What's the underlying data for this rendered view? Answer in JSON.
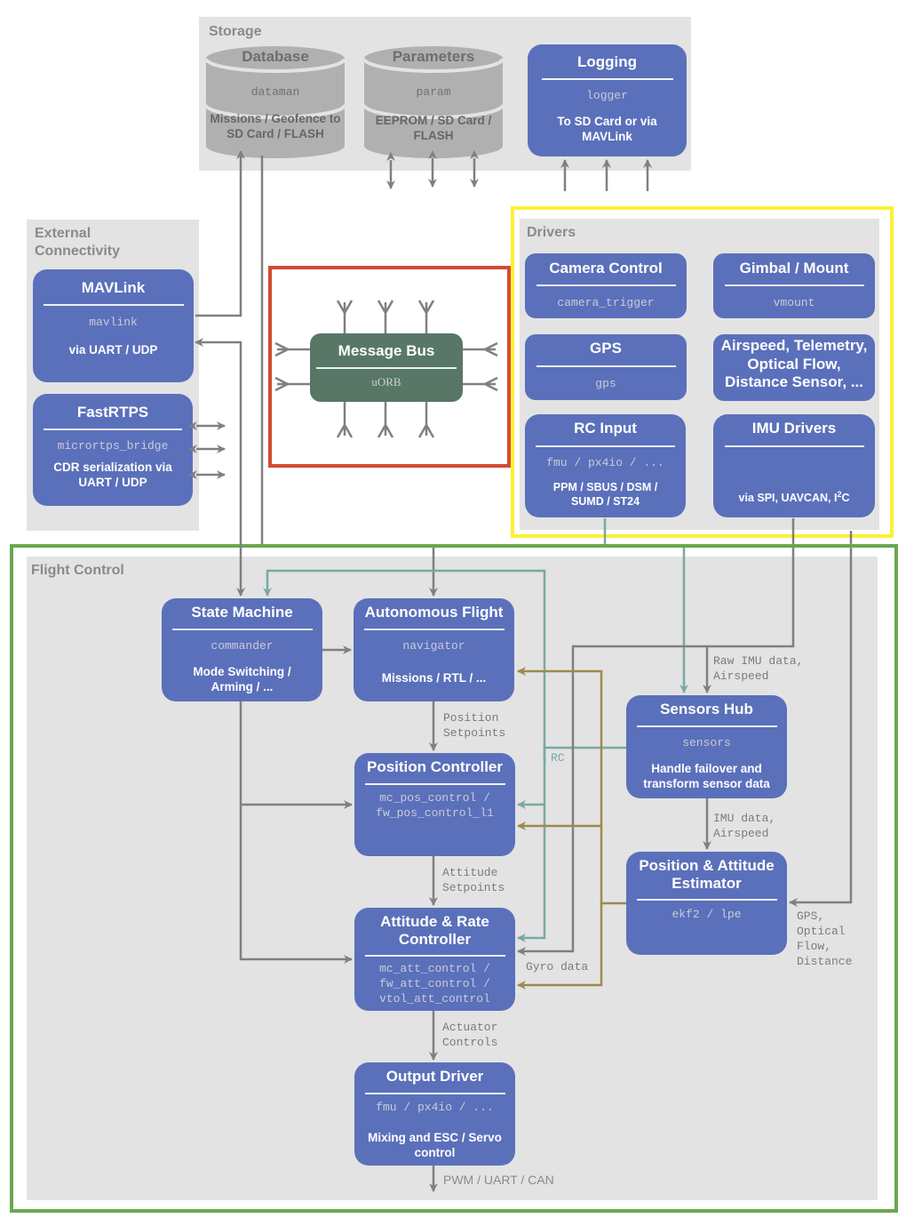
{
  "colors": {
    "module_box": "#5b70bb",
    "message_bus": "#587766",
    "group_bg": "#e3e3e3",
    "storage_cylinder": "#b0b0b0",
    "connector_gray": "#808080",
    "connector_teal": "#7aa8a4",
    "connector_olive": "#9c8a4c",
    "highlight_red": "#d34a34",
    "highlight_yellow": "#fdf035",
    "highlight_green": "#6aa84f"
  },
  "storage": {
    "title": "Storage",
    "database": {
      "title": "Database",
      "module": "dataman",
      "desc": "Missions / Geofence to SD Card / FLASH"
    },
    "parameters": {
      "title": "Parameters",
      "module": "param",
      "desc": "EEPROM / SD Card / FLASH"
    },
    "logging": {
      "title": "Logging",
      "module": "logger",
      "desc": "To SD Card or via MAVLink"
    }
  },
  "external": {
    "title": "External Connectivity",
    "mavlink": {
      "title": "MAVLink",
      "module": "mavlink",
      "desc": "via UART / UDP"
    },
    "fastrtps": {
      "title": "FastRTPS",
      "module": "micrortps_bridge",
      "desc": "CDR serialization via UART / UDP"
    }
  },
  "message_bus": {
    "title": "Message Bus",
    "module": "uORB"
  },
  "drivers": {
    "title": "Drivers",
    "camera": {
      "title": "Camera Control",
      "module": "camera_trigger"
    },
    "gimbal": {
      "title": "Gimbal / Mount",
      "module": "vmount"
    },
    "gps": {
      "title": "GPS",
      "module": "gps"
    },
    "other": {
      "title": "Airspeed, Telemetry, Optical Flow, Distance Sensor, ..."
    },
    "rc": {
      "title": "RC Input",
      "module": "fmu / px4io / ...",
      "desc": "PPM / SBUS / DSM / SUMD / ST24"
    },
    "imu": {
      "title": "IMU Drivers",
      "desc_main": "via SPI, UAVCAN, I",
      "desc_sup": "2",
      "desc_end": "C"
    }
  },
  "flight_control": {
    "title": "Flight Control",
    "state_machine": {
      "title": "State Machine",
      "module": "commander",
      "desc": "Mode Switching / Arming / ..."
    },
    "autonomous": {
      "title": "Autonomous Flight",
      "module": "navigator",
      "desc": "Missions / RTL / ..."
    },
    "position": {
      "title": "Position Controller",
      "module": "mc_pos_control / fw_pos_control_l1"
    },
    "attitude": {
      "title": "Attitude & Rate Controller",
      "module": "mc_att_control / fw_att_control / vtol_att_control"
    },
    "output": {
      "title": "Output Driver",
      "module": "fmu / px4io / ...",
      "desc": "Mixing and ESC / Servo control"
    },
    "sensors": {
      "title": "Sensors Hub",
      "module": "sensors",
      "desc": "Handle failover and transform sensor data"
    },
    "estimator": {
      "title": "Position & Attitude Estimator",
      "module": "ekf2 / lpe"
    }
  },
  "edge_labels": {
    "position_setpoints": "Position\nSetpoints",
    "attitude_setpoints": "Attitude\nSetpoints",
    "actuator_controls": "Actuator\nControls",
    "pwm": "PWM / UART / CAN",
    "raw_imu": "Raw IMU data,\nAirspeed",
    "imu_data": "IMU data,\nAirspeed",
    "gps_flow": "GPS,\nOptical\nFlow,\nDistance",
    "rc": "RC",
    "gyro": "Gyro data"
  }
}
